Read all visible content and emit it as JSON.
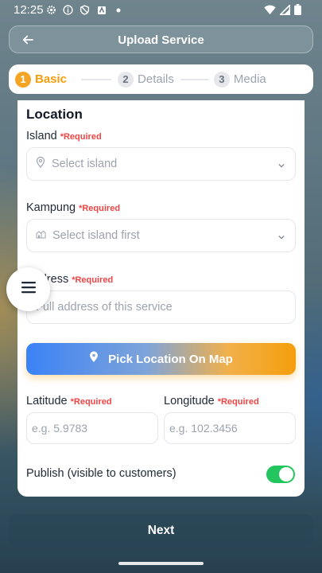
{
  "status_bar": {
    "time": "12:25",
    "icons": [
      "gear-icon",
      "info-icon",
      "shield-icon",
      "news-icon",
      "dot-icon"
    ],
    "right_icons": [
      "wifi-icon",
      "signal-icon",
      "battery-icon"
    ]
  },
  "appbar": {
    "title": "Upload Service"
  },
  "stepper": {
    "steps": [
      {
        "num": "1",
        "label": "Basic"
      },
      {
        "num": "2",
        "label": "Details"
      },
      {
        "num": "3",
        "label": "Media"
      }
    ],
    "active_index": 0
  },
  "form": {
    "section_title": "Location",
    "island": {
      "label": "Island",
      "required": "*Required",
      "placeholder": "Select island"
    },
    "kampung": {
      "label": "Kampung",
      "required": "*Required",
      "placeholder": "Select island first"
    },
    "address": {
      "label": "Address",
      "required": "*Required",
      "placeholder": "Full address of this service"
    },
    "map_button": "Pick Location On Map",
    "latitude": {
      "label": "Latitude",
      "required": "*Required",
      "placeholder": "e.g. 5.9783"
    },
    "longitude": {
      "label": "Longitude",
      "required": "*Required",
      "placeholder": "e.g. 102.3456"
    },
    "publish": {
      "label": "Publish (visible to customers)",
      "enabled": true
    }
  },
  "next_button": "Next",
  "colors": {
    "accent": "#f59e0b",
    "required": "#ef4444",
    "toggle_on": "#22c55e",
    "map_gradient_start": "#3b82f6",
    "map_gradient_end": "#f59e0b"
  }
}
